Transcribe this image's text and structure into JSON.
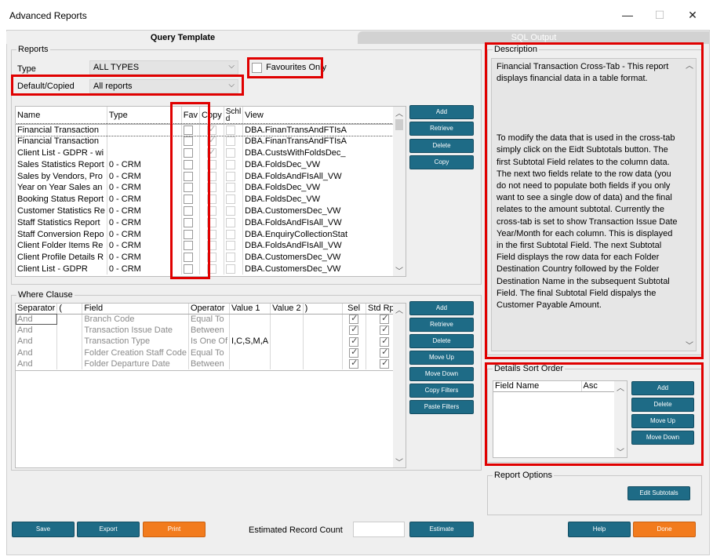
{
  "window": {
    "title": "Advanced Reports",
    "minimize": "—",
    "maximize": "☐",
    "close": "✕"
  },
  "tabs": {
    "query_template": "Query Template",
    "sql_output": "SQL Output"
  },
  "reports": {
    "legend": "Reports",
    "type_label": "Type",
    "type_value": "ALL TYPES",
    "default_label": "Default/Copied",
    "default_value": "All reports",
    "favourites_label": "Favourites Only",
    "columns": {
      "name": "Name",
      "type": "Type",
      "fav": "Fav",
      "copy": "Copy",
      "schld": "Schl\nd",
      "view": "View"
    },
    "rows": [
      {
        "name": "Financial Transaction",
        "type": "",
        "view": "DBA.FinanTransAndFTIsA",
        "fav": false,
        "copy": true
      },
      {
        "name": "Financial Transaction",
        "type": "",
        "view": "DBA.FinanTransAndFTIsA",
        "fav": false,
        "copy": true
      },
      {
        "name": "Client List - GDPR - wi",
        "type": "",
        "view": "DBA.CustsWithFoldsDec_",
        "fav": false,
        "copy": true
      },
      {
        "name": "Sales Statistics Report",
        "type": "0 - CRM",
        "view": "DBA.FoldsDec_VW",
        "fav": false,
        "copy": false
      },
      {
        "name": "Sales by Vendors, Pro",
        "type": "0 - CRM",
        "view": "DBA.FoldsAndFIsAll_VW",
        "fav": false,
        "copy": false
      },
      {
        "name": "Year on Year Sales an",
        "type": "0 - CRM",
        "view": "DBA.FoldsDec_VW",
        "fav": false,
        "copy": false
      },
      {
        "name": "Booking Status Report",
        "type": "0 - CRM",
        "view": "DBA.FoldsDec_VW",
        "fav": false,
        "copy": false
      },
      {
        "name": "Customer Statistics Re",
        "type": "0 - CRM",
        "view": "DBA.CustomersDec_VW",
        "fav": false,
        "copy": false
      },
      {
        "name": "Staff Statistics Report",
        "type": "0 - CRM",
        "view": "DBA.FoldsAndFIsAll_VW",
        "fav": false,
        "copy": false
      },
      {
        "name": "Staff Conversion Repo",
        "type": "0 - CRM",
        "view": "DBA.EnquiryCollectionStat",
        "fav": false,
        "copy": false
      },
      {
        "name": "Client Folder Items Re",
        "type": "0 - CRM",
        "view": "DBA.FoldsAndFIsAll_VW",
        "fav": false,
        "copy": false
      },
      {
        "name": "Client Profile Details R",
        "type": "0 - CRM",
        "view": "DBA.CustomersDec_VW",
        "fav": false,
        "copy": false
      },
      {
        "name": "Client List - GDPR",
        "type": "0 - CRM",
        "view": "DBA.CustomersDec_VW",
        "fav": false,
        "copy": false
      }
    ],
    "buttons": {
      "add": "Add",
      "retrieve": "Retrieve",
      "delete": "Delete",
      "copy": "Copy"
    }
  },
  "where": {
    "legend": "Where Clause",
    "columns": {
      "separator": "Separator",
      "paren_open": "(",
      "field": "Field",
      "operator": "Operator",
      "value1": "Value 1",
      "value2": "Value 2",
      "paren_close": ")",
      "sel": "Sel",
      "std_rpts": "Std Rpts"
    },
    "rows": [
      {
        "separator": "And",
        "field": "Branch Code",
        "operator": "Equal To",
        "value1": "",
        "sel": true,
        "std": true
      },
      {
        "separator": "And",
        "field": "Transaction Issue Date",
        "operator": "Between",
        "value1": "",
        "sel": true,
        "std": true
      },
      {
        "separator": "And",
        "field": "Transaction Type",
        "operator": "Is One Of",
        "value1": "I,C,S,M,A",
        "sel": true,
        "std": true
      },
      {
        "separator": "And",
        "field": "Folder Creation Staff Code",
        "operator": "Equal To",
        "value1": "",
        "sel": true,
        "std": true
      },
      {
        "separator": "And",
        "field": "Folder Departure Date",
        "operator": "Between",
        "value1": "",
        "sel": true,
        "std": true
      }
    ],
    "buttons": {
      "add": "Add",
      "retrieve": "Retrieve",
      "delete": "Delete",
      "move_up": "Move Up",
      "move_down": "Move Down",
      "copy_filters": "Copy Filters",
      "paste_filters": "Paste Filters"
    }
  },
  "description": {
    "legend": "Description",
    "text": "Financial Transaction Cross-Tab - This report displays financial data in a table format.\n\n\n\n\nTo modify the data that is used in the cross-tab simply click on the Eidt Subtotals button. The first Subtotal Field relates to the column data. The next two fields relate to the row data (you do not need to populate both fields if you only want to see a single dow of data) and the final relates to the amount subtotal. Currently the cross-tab is set to show Transaction Issue Date Year/Month for each column. This is displayed in the first Subtotal Field. The next Subtotal Field displays the row data for each Folder Destination Country followed by the Folder Destination Name in the subsequent Subtotal Field. The final Subtotal Field dispalys the Customer Payable Amount."
  },
  "sort_order": {
    "legend": "Details Sort Order",
    "columns": {
      "field_name": "Field Name",
      "asc": "Asc"
    },
    "buttons": {
      "add": "Add",
      "delete": "Delete",
      "move_up": "Move Up",
      "move_down": "Move Down"
    }
  },
  "report_options": {
    "legend": "Report Options",
    "edit_subtotals": "Edit Subtotals"
  },
  "footer": {
    "save": "Save",
    "export": "Export",
    "print": "Print",
    "record_count_label": "Estimated Record Count",
    "record_count_value": "",
    "estimate": "Estimate",
    "help": "Help",
    "done": "Done"
  },
  "colors": {
    "button_blue": "#1e6b86",
    "button_orange": "#f27b1d",
    "highlight_red": "#e00000"
  }
}
